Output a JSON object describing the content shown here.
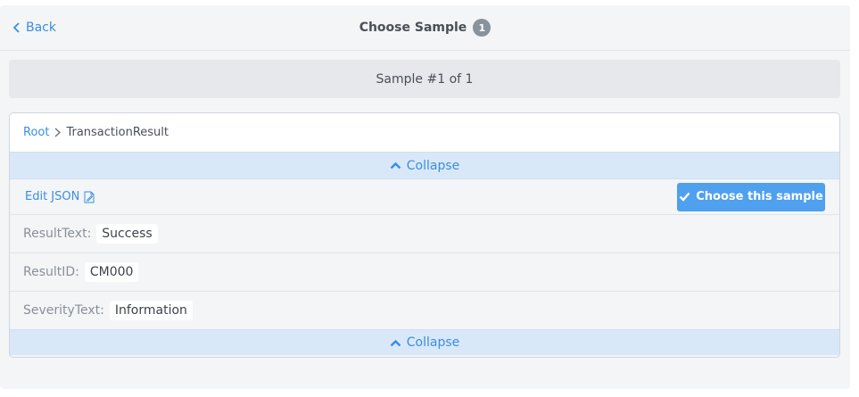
{
  "header": {
    "back_label": "Back",
    "title": "Choose Sample",
    "badge_count": "1"
  },
  "pager": {
    "label": "Sample #1 of 1"
  },
  "breadcrumb": {
    "root": "Root",
    "current": "TransactionResult"
  },
  "collapse": {
    "label": "Collapse"
  },
  "actions": {
    "edit_json_label": "Edit JSON",
    "choose_label": "Choose this sample"
  },
  "fields": [
    {
      "label": "ResultText:",
      "value": "Success"
    },
    {
      "label": "ResultID:",
      "value": "CM000"
    },
    {
      "label": "SeverityText:",
      "value": "Information"
    }
  ],
  "colors": {
    "accent": "#3a8ee0",
    "button": "#4fa0ee",
    "collapse_bg": "#d9e8f8"
  },
  "icons": {
    "back": "chevron-left-icon",
    "crumb_separator": "chevron-right-icon",
    "collapse": "chevron-up-icon",
    "edit_json": "edit-document-icon",
    "choose": "check-icon"
  }
}
